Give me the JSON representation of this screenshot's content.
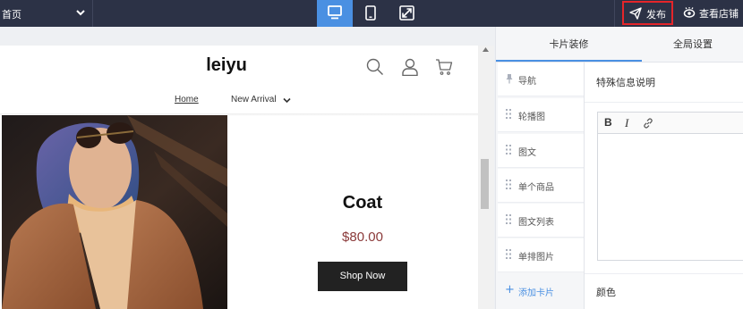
{
  "topbar": {
    "page_select": "首页",
    "publish_label": "发布",
    "view_store_label": "查看店铺",
    "devices": [
      "desktop-icon",
      "mobile-icon",
      "fullscreen-icon"
    ],
    "active_device": "desktop",
    "accent_color": "#4a90e2",
    "highlight_color": "#e5252a"
  },
  "store": {
    "logo": "leiyu",
    "nav": {
      "home": "Home",
      "new_arrival": "New Arrival"
    },
    "header_icons": [
      "search-icon",
      "user-icon",
      "cart-icon"
    ],
    "banner": {
      "title": "Coat",
      "price": "$80.00",
      "button": "Shop Now"
    }
  },
  "panel": {
    "tabs": [
      {
        "label": "卡片装修",
        "active": true
      },
      {
        "label": "全局设置",
        "active": false
      }
    ],
    "cards": [
      {
        "label": "导航",
        "icon": "pin-icon"
      },
      {
        "label": "轮播图",
        "icon": "drag-handle-icon"
      },
      {
        "label": "图文",
        "icon": "drag-handle-icon"
      },
      {
        "label": "单个商品",
        "icon": "drag-handle-icon"
      },
      {
        "label": "图文列表",
        "icon": "drag-handle-icon"
      },
      {
        "label": "单排图片",
        "icon": "drag-handle-icon"
      }
    ],
    "add_card": "添加卡片",
    "section_title": "特殊信息说明",
    "editor_tools": {
      "bold": "B",
      "italic": "I",
      "link": "link-icon"
    },
    "editor_value": "",
    "color_label": "颜色"
  }
}
